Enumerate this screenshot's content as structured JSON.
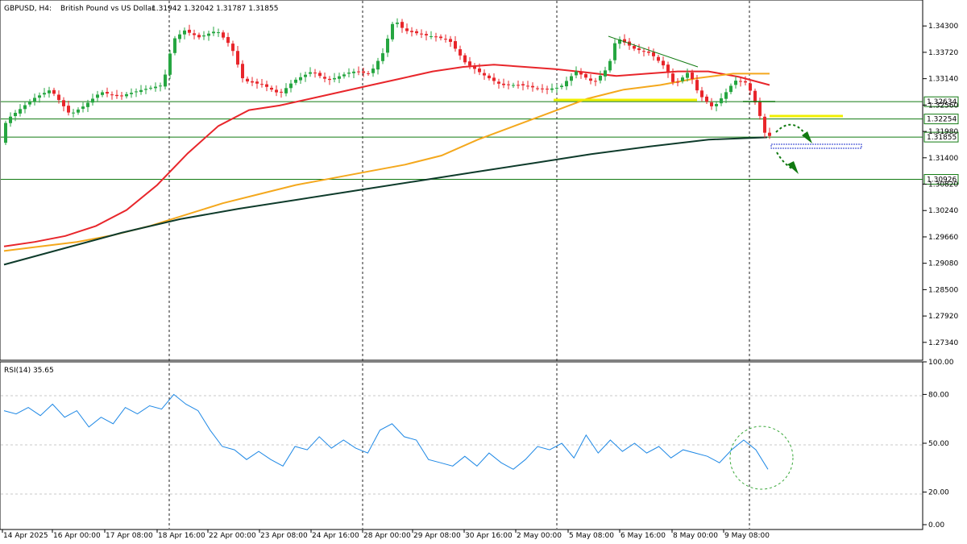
{
  "header": {
    "symbol": "GBPUSD, H4:",
    "description": "British Pound vs US Dollar",
    "ohlc": "1.31942 1.32042 1.31787 1.31855"
  },
  "rsi_header": "RSI(14) 35.65",
  "colors": {
    "bull": "#26a641",
    "bear": "#e8262b",
    "ema_fast": "#e8262b",
    "ema_mid": "#f4a81d",
    "ema_slow": "#0e3b2b",
    "level": "#117a11",
    "yellow": "#f0f000",
    "rsi": "#1e88e5"
  },
  "price_axis": {
    "labels": [
      "1.34300",
      "1.33720",
      "1.33140",
      "1.32560",
      "1.31980",
      "1.31400",
      "1.30820",
      "1.30240",
      "1.29660",
      "1.29080",
      "1.28500",
      "1.27920",
      "1.27340"
    ],
    "min": 1.27,
    "max": 1.348
  },
  "rsi_axis": {
    "labels": [
      "100.00",
      "80.00",
      "50.00",
      "20.00",
      "0.00"
    ]
  },
  "time_axis": [
    "14 Apr 2025",
    "16 Apr 00:00",
    "17 Apr 08:00",
    "18 Apr 16:00",
    "22 Apr 00:00",
    "23 Apr 08:00",
    "24 Apr 16:00",
    "28 Apr 00:00",
    "29 Apr 08:00",
    "30 Apr 16:00",
    "2 May 00:00",
    "5 May 08:00",
    "6 May 16:00",
    "8 May 00:00",
    "9 May 08:00"
  ],
  "levels": [
    {
      "price": 1.32634,
      "label": "1.32634"
    },
    {
      "price": 1.32254,
      "label": "1.32254"
    },
    {
      "price": 1.31855,
      "label": "1.31855"
    },
    {
      "price": 1.30926,
      "label": "1.30926"
    }
  ],
  "chart_data": {
    "type": "candlestick",
    "symbol": "GBPUSD",
    "timeframe": "H4",
    "ylim": [
      1.27,
      1.348
    ],
    "series": [
      {
        "name": "",
        "role": "ema_fast_red",
        "values": [
          1.2945,
          1.2955,
          1.2968,
          1.299,
          1.3025,
          1.308,
          1.315,
          1.321,
          1.3245,
          1.3255,
          1.327,
          1.3285,
          1.33,
          1.3315,
          1.333,
          1.334,
          1.3345,
          1.334,
          1.3335,
          1.3328,
          1.332,
          1.3325,
          1.333,
          1.333,
          1.3318,
          1.33
        ]
      },
      {
        "name": "",
        "role": "ema_mid_orange",
        "values": [
          1.2935,
          1.2945,
          1.2955,
          1.297,
          1.299,
          1.3015,
          1.304,
          1.306,
          1.308,
          1.3095,
          1.311,
          1.3125,
          1.3145,
          1.318,
          1.321,
          1.324,
          1.327,
          1.329,
          1.33,
          1.3315,
          1.3325,
          1.3325
        ]
      },
      {
        "name": "",
        "role": "ema_slow_darkgreen",
        "values": [
          1.2905,
          1.294,
          1.2975,
          1.3005,
          1.3028,
          1.3048,
          1.3068,
          1.3088,
          1.3108,
          1.3128,
          1.3148,
          1.3165,
          1.318,
          1.3185
        ]
      }
    ],
    "rsi": {
      "name": "RSI(14)",
      "last": 35.65,
      "levels": [
        80,
        50,
        20
      ],
      "values": [
        70,
        68,
        72,
        67,
        74,
        66,
        70,
        60,
        66,
        62,
        72,
        68,
        73,
        71,
        80,
        74,
        70,
        58,
        48,
        46,
        40,
        45,
        40,
        36,
        48,
        46,
        54,
        47,
        52,
        47,
        44,
        58,
        62,
        54,
        52,
        40,
        38,
        36,
        42,
        36,
        44,
        38,
        34,
        40,
        48,
        46,
        50,
        41,
        55,
        44,
        52,
        45,
        50,
        44,
        48,
        41,
        46,
        44,
        42,
        38,
        46,
        52,
        46,
        34
      ]
    }
  }
}
